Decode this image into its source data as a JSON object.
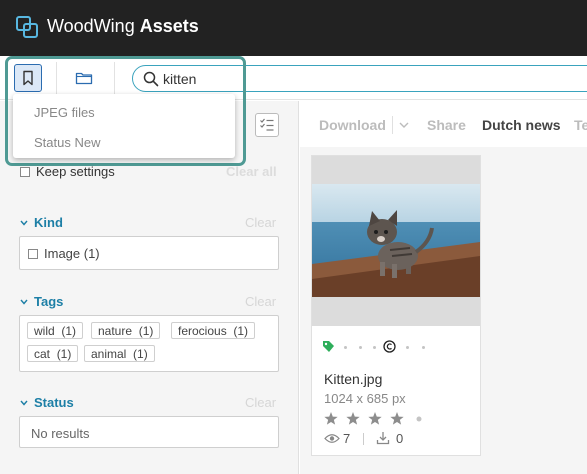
{
  "header": {
    "app_name_regular": "WoodWing ",
    "app_name_bold": "Assets",
    "logo_icon": "woodwing-logo-icon"
  },
  "toolbar": {
    "bookmark_icon": "bookmark-icon",
    "folder_icon": "folder-icon"
  },
  "search": {
    "value": "kitten",
    "icon": "search-icon"
  },
  "saved_searches": {
    "items": [
      "JPEG files",
      "Status New"
    ]
  },
  "filters": {
    "keep_settings_label": "Keep settings",
    "clear_all_label": "Clear all",
    "facets": [
      {
        "title": "Kind",
        "clear_label": "Clear",
        "items": [
          {
            "label": "Image (1)"
          }
        ]
      },
      {
        "title": "Tags",
        "clear_label": "Clear",
        "items": [
          {
            "label": "wild",
            "count": "(1)"
          },
          {
            "label": "nature",
            "count": "(1)"
          },
          {
            "label": "ferocious",
            "count": "(1)"
          },
          {
            "label": "cat",
            "count": "(1)"
          },
          {
            "label": "animal",
            "count": "(1)"
          }
        ]
      },
      {
        "title": "Status",
        "clear_label": "Clear",
        "empty_text": "No results"
      }
    ]
  },
  "actions": {
    "download": "Download",
    "share": "Share",
    "dutch_news": "Dutch news",
    "truncated": "Te"
  },
  "asset": {
    "file_name": "Kitten.jpg",
    "dimensions": "1024 x 685 px",
    "rating": 4,
    "rating_max": 5,
    "views": "7",
    "downloads": "0",
    "tag_color": "#2eae5b"
  },
  "colors": {
    "header_bg": "#222222",
    "accent": "#1d7fa6",
    "highlight_frame": "#4f9a94"
  }
}
